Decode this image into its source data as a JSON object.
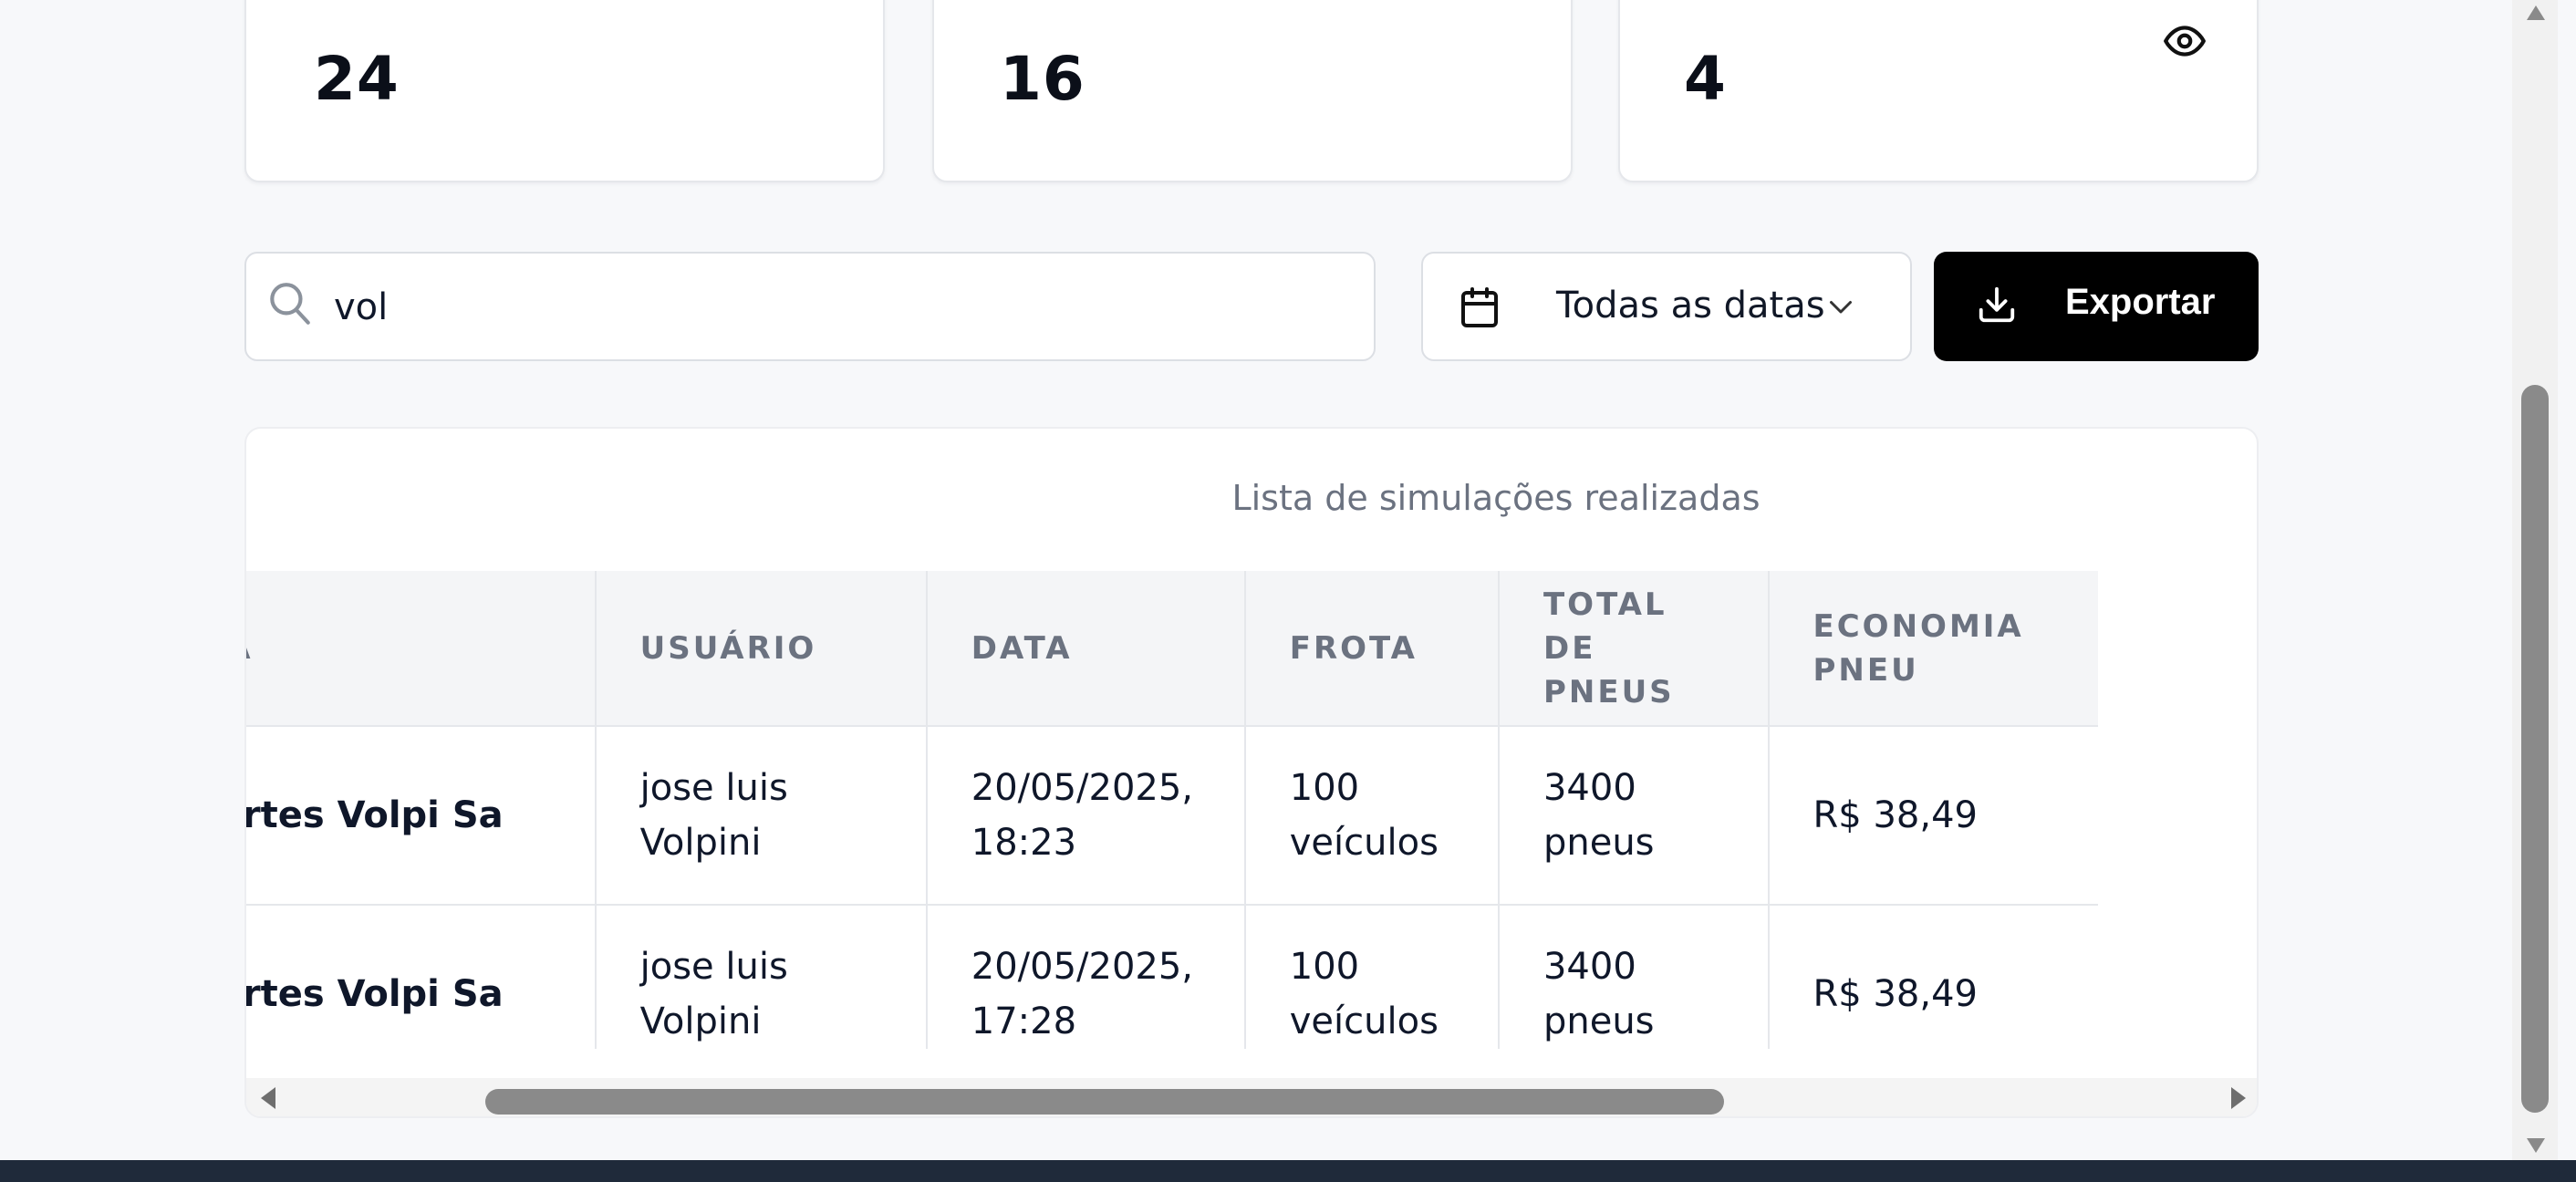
{
  "stats": {
    "cards": [
      {
        "value": "24"
      },
      {
        "value": "16"
      },
      {
        "value": "4",
        "icon": "eye-icon"
      }
    ]
  },
  "filters": {
    "search": {
      "value": "vol",
      "icon": "search-icon"
    },
    "date": {
      "label": "Todas as datas",
      "icon": "calendar-icon",
      "chevron": "chevron-down-icon"
    },
    "export": {
      "label": "Exportar",
      "icon": "download-icon"
    }
  },
  "table": {
    "caption": "Lista de simulações realizadas",
    "headers": [
      "ESA",
      "USUÁRIO",
      "DATA",
      "FROTA",
      "TOTAL DE PNEUS",
      "ECONOMIA PNEU"
    ],
    "rows": [
      {
        "empresa": "ortes Volpi Sa",
        "usuario": "jose luis Volpini",
        "data": "20/05/2025, 18:23",
        "frota": "100 veículos",
        "total_pneus": "3400 pneus",
        "economia": "R$ 38,49"
      },
      {
        "empresa": "ortes Volpi Sa",
        "usuario": "jose luis Volpini",
        "data": "20/05/2025, 17:28",
        "frota": "100 veículos",
        "total_pneus": "3400 pneus",
        "economia": "R$ 38,49"
      }
    ]
  },
  "colors": {
    "page_bg": "#f7f8fa",
    "card_bg": "#ffffff",
    "primary_button": "#000000",
    "muted_text": "#6b7280"
  }
}
